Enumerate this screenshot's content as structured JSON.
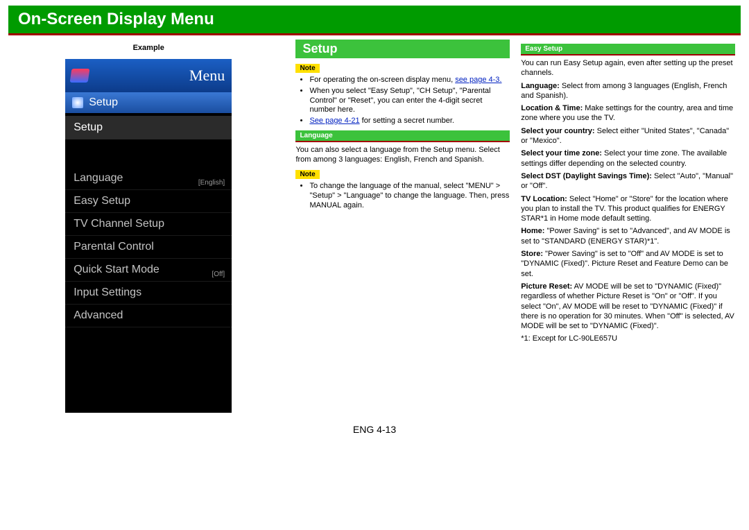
{
  "banner": "On-Screen Display Menu",
  "example_label": "Example",
  "tv": {
    "menu_title": "Menu",
    "category": "Setup",
    "selected": "Setup",
    "items": [
      {
        "label": "Language",
        "value": "[English]"
      },
      {
        "label": "Easy Setup",
        "value": ""
      },
      {
        "label": "TV Channel Setup",
        "value": ""
      },
      {
        "label": "Parental Control",
        "value": ""
      },
      {
        "label": "Quick Start Mode",
        "value": "[Off]"
      },
      {
        "label": "Input Settings",
        "value": ""
      },
      {
        "label": "Advanced",
        "value": ""
      }
    ]
  },
  "col2": {
    "title": "Setup",
    "note1_label": "Note",
    "note1_items": [
      "For operating the on-screen display menu, ",
      "When you select \"Easy Setup\", \"CH Setup\", \"Parental Control\" or \"Reset\", you can enter the 4-digit secret number here.",
      " for setting a secret number."
    ],
    "note1_link1": "see page 4-3.",
    "note1_link2": "See page 4-21",
    "lang_title": "Language",
    "lang_text": "You can also select a language from the Setup menu. Select from among 3 languages: English, French and Spanish.",
    "note2_label": "Note",
    "note2_item": "To change the language of the manual, select \"MENU\" > \"Setup\" > \"Language\" to change the language. Then, press MANUAL again."
  },
  "col3": {
    "es_title": "Easy Setup",
    "intro": "You can run Easy Setup again, even after setting up the preset channels.",
    "lines": [
      {
        "b": "Language:",
        "t": " Select from among 3 languages (English, French and Spanish)."
      },
      {
        "b": "Location & Time:",
        "t": " Make settings for the country, area and time zone where you use the TV."
      },
      {
        "b": "Select your country:",
        "t": " Select either \"United States\", \"Canada\" or \"Mexico\"."
      },
      {
        "b": "Select your time zone:",
        "t": " Select your time zone. The available settings differ depending on the selected country."
      },
      {
        "b": "Select DST (Daylight Savings Time):",
        "t": " Select \"Auto\", \"Manual\" or \"Off\"."
      },
      {
        "b": "TV Location:",
        "t": " Select \"Home\" or \"Store\" for the location where you plan to install the TV. This product qualifies for ENERGY STAR*1 in Home mode default setting."
      },
      {
        "b": "Home:",
        "t": " \"Power Saving\" is set to \"Advanced\", and AV MODE is set to \"STANDARD (ENERGY STAR)*1\"."
      },
      {
        "b": "Store:",
        "t": " \"Power Saving\" is set to \"Off\" and AV MODE is set to \"DYNAMIC (Fixed)\". Picture Reset and Feature Demo can be set."
      },
      {
        "b": "Picture Reset:",
        "t": " AV MODE will be set to \"DYNAMIC (Fixed)\" regardless of whether Picture Reset is \"On\" or \"Off\". If you select \"On\", AV MODE will be reset to \"DYNAMIC (Fixed)\" if there is no operation for 30 minutes. When \"Off\" is selected, AV MODE will be set to \"DYNAMIC (Fixed)\"."
      }
    ],
    "footnote": "*1: Except for LC-90LE657U"
  },
  "page_number": "ENG 4-13"
}
